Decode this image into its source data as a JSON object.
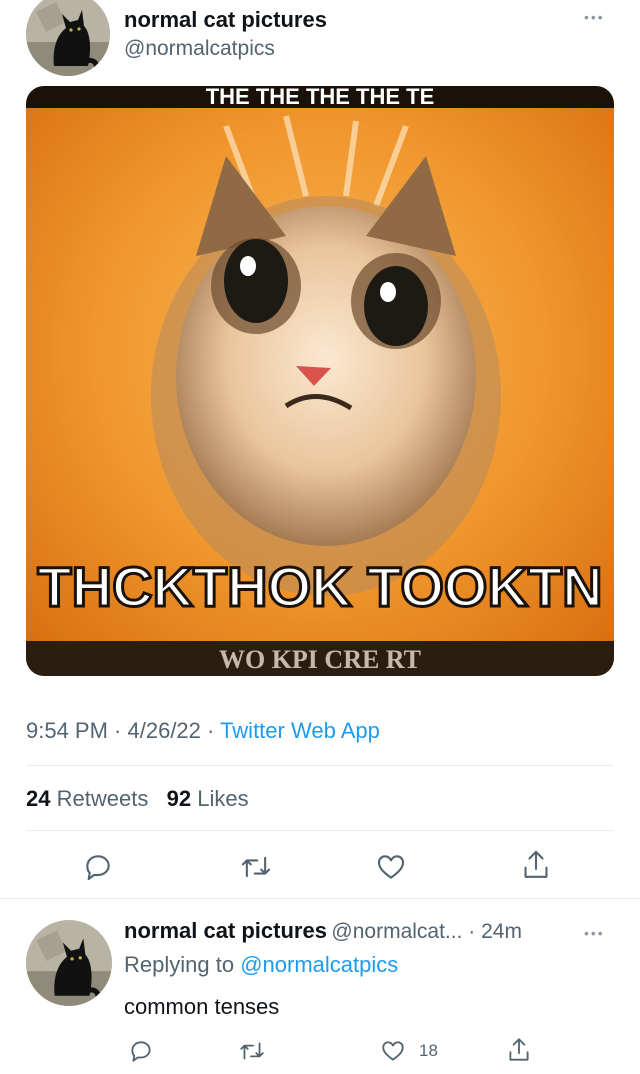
{
  "tweet": {
    "author_name": "normal cat pictures",
    "author_handle": "@normalcatpics",
    "more_label": "•••",
    "image": {
      "top_caption": "THE THE THE THE TE",
      "bottom_caption": "THCKTHOK TOOKTN",
      "bottom_strip": "WO KPI CRE RT"
    },
    "time": "9:54 PM",
    "date": "4/26/22",
    "separator": " · ",
    "source": "Twitter Web App",
    "retweets_count": "24",
    "retweets_label": "Retweets",
    "likes_count": "92",
    "likes_label": "Likes",
    "actions": [
      "reply-icon",
      "retweet-icon",
      "like-icon",
      "share-icon"
    ]
  },
  "reply": {
    "author_name": "normal cat pictures",
    "author_handle": "@normalcat...",
    "separator": " · ",
    "time_ago": "24m",
    "more_label": "•••",
    "replying_prefix": "Replying to ",
    "replying_mention": "@normalcatpics",
    "text": "common tenses",
    "like_count": "18",
    "actions": [
      "reply-icon",
      "retweet-icon",
      "like-icon",
      "share-icon"
    ]
  },
  "colors": {
    "accent": "#1d9bf0",
    "secondary_text": "#536471",
    "primary_text": "#0f1419",
    "divider": "#e6ecf0"
  }
}
